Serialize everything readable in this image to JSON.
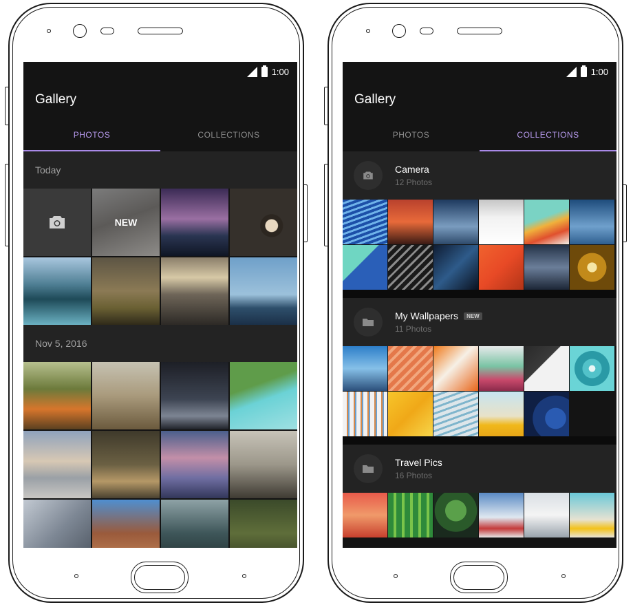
{
  "status": {
    "time": "1:00"
  },
  "app": {
    "title": "Gallery"
  },
  "tabs": {
    "photos": "PHOTOS",
    "collections": "COLLECTIONS"
  },
  "photos_screen": {
    "sections": [
      {
        "label": "Today",
        "new_label": "NEW"
      },
      {
        "label": "Nov 5, 2016"
      }
    ]
  },
  "collections_screen": {
    "collections": [
      {
        "name": "Camera",
        "count": "12 Photos",
        "icon": "camera-icon"
      },
      {
        "name": "My Wallpapers",
        "count": "11 Photos",
        "badge": "NEW",
        "icon": "folder-icon"
      },
      {
        "name": "Travel Pics",
        "count": "16 Photos",
        "icon": "folder-icon"
      }
    ]
  },
  "colors": {
    "screen_bg": "#141414",
    "section_bg": "#232323",
    "accent": "#b99cf0",
    "inactive_tab": "#8e8e8e"
  }
}
